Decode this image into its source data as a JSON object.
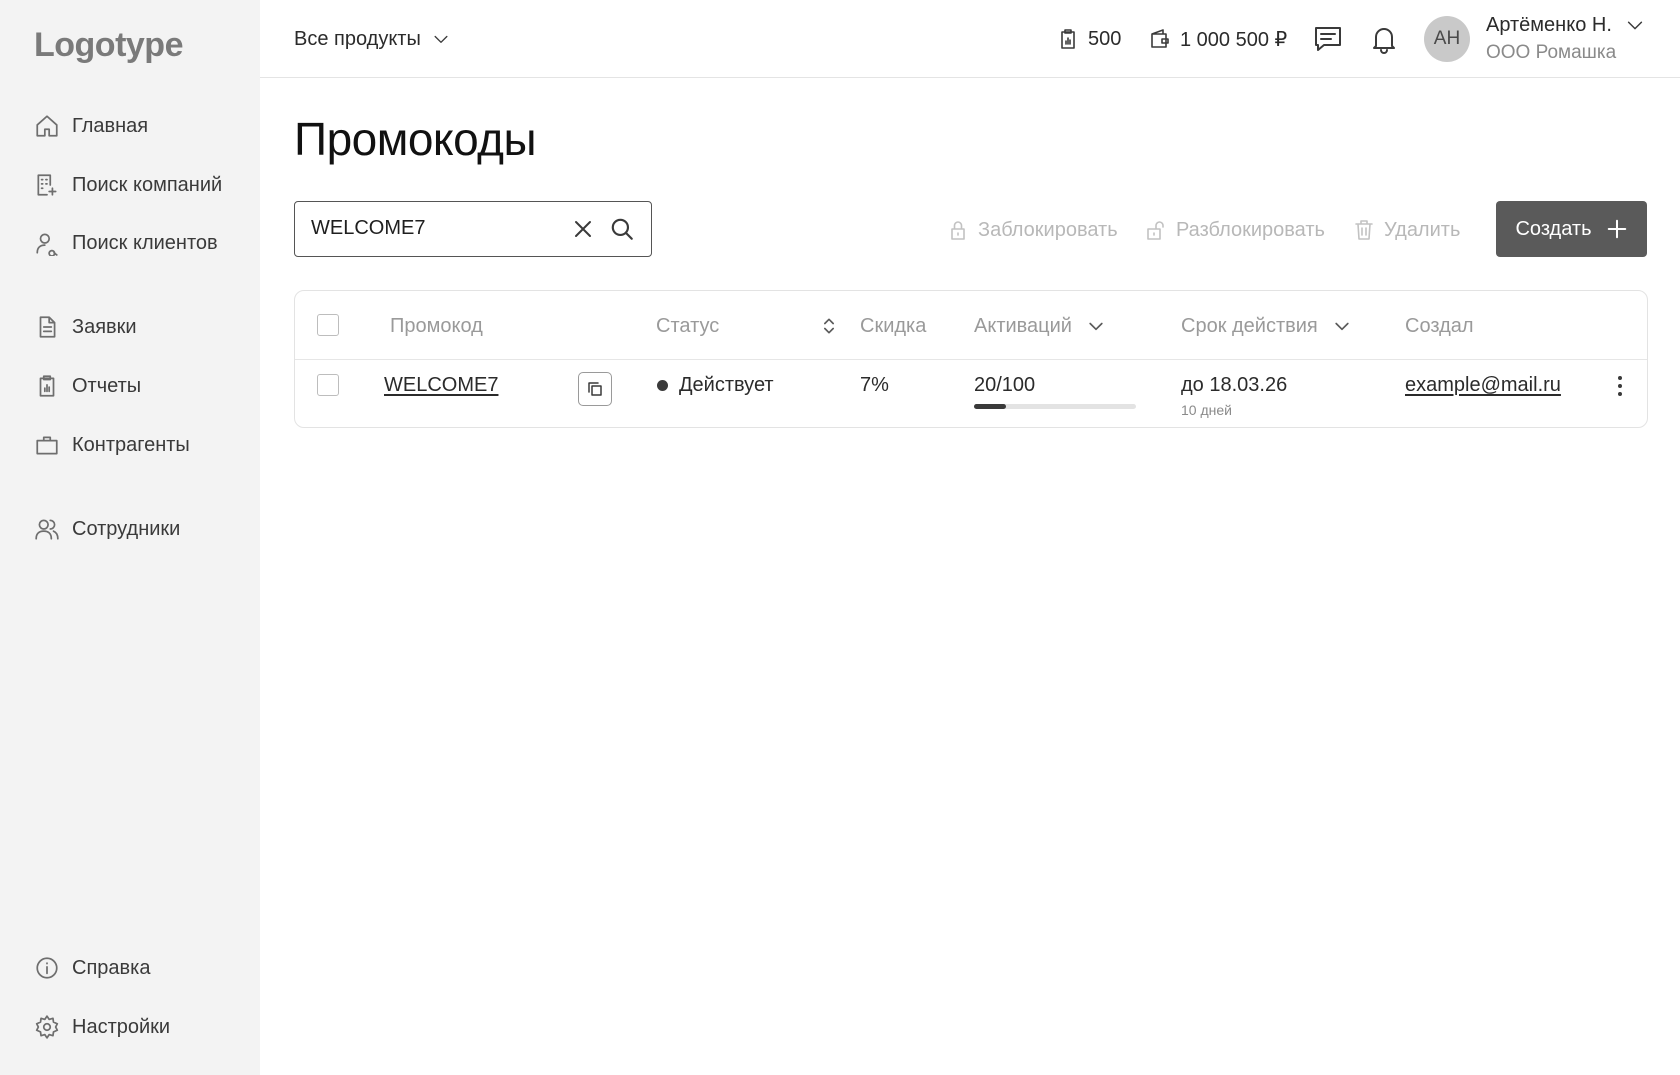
{
  "brand": {
    "logo": "Logotype"
  },
  "sidebar": {
    "items": [
      {
        "label": "Главная",
        "icon": "home-icon"
      },
      {
        "label": "Поиск компаний",
        "icon": "building-search-icon"
      },
      {
        "label": "Поиск клиентов",
        "icon": "user-search-icon"
      },
      {
        "label": "Заявки",
        "icon": "document-icon"
      },
      {
        "label": "Отчеты",
        "icon": "clipboard-chart-icon"
      },
      {
        "label": "Контрагенты",
        "icon": "briefcase-icon"
      },
      {
        "label": "Сотрудники",
        "icon": "users-icon"
      }
    ],
    "footer": [
      {
        "label": "Справка",
        "icon": "info-icon"
      },
      {
        "label": "Настройки",
        "icon": "gear-icon"
      }
    ]
  },
  "header": {
    "product_select": "Все продукты",
    "reports_count": "500",
    "balance": "1 000 500 ₽",
    "user": {
      "initials": "АН",
      "name": "Артёменко Н.",
      "org": "ООО Ромашка"
    }
  },
  "page": {
    "title": "Промокоды",
    "search": {
      "value": "WELCOME7",
      "placeholder": ""
    },
    "actions": {
      "block": "Заблокировать",
      "unblock": "Разблокировать",
      "delete": "Удалить",
      "create": "Создать"
    }
  },
  "table": {
    "columns": {
      "code": "Промокод",
      "status": "Статус",
      "discount": "Скидка",
      "activations": "Активаций",
      "validity": "Срок действия",
      "creator": "Создал"
    },
    "rows": [
      {
        "code": "WELCOME7",
        "status": "Действует",
        "discount": "7%",
        "activations": "20/100",
        "activations_progress": 0.2,
        "validity": "до 18.03.26",
        "validity_left": "10 дней",
        "creator": "example@mail.ru"
      }
    ]
  },
  "colors": {
    "sidebar_bg": "#f3f3f3",
    "primary_button": "#5a5a5a",
    "muted_text": "#9a9a9a",
    "disabled_text": "#b8b8b8"
  }
}
